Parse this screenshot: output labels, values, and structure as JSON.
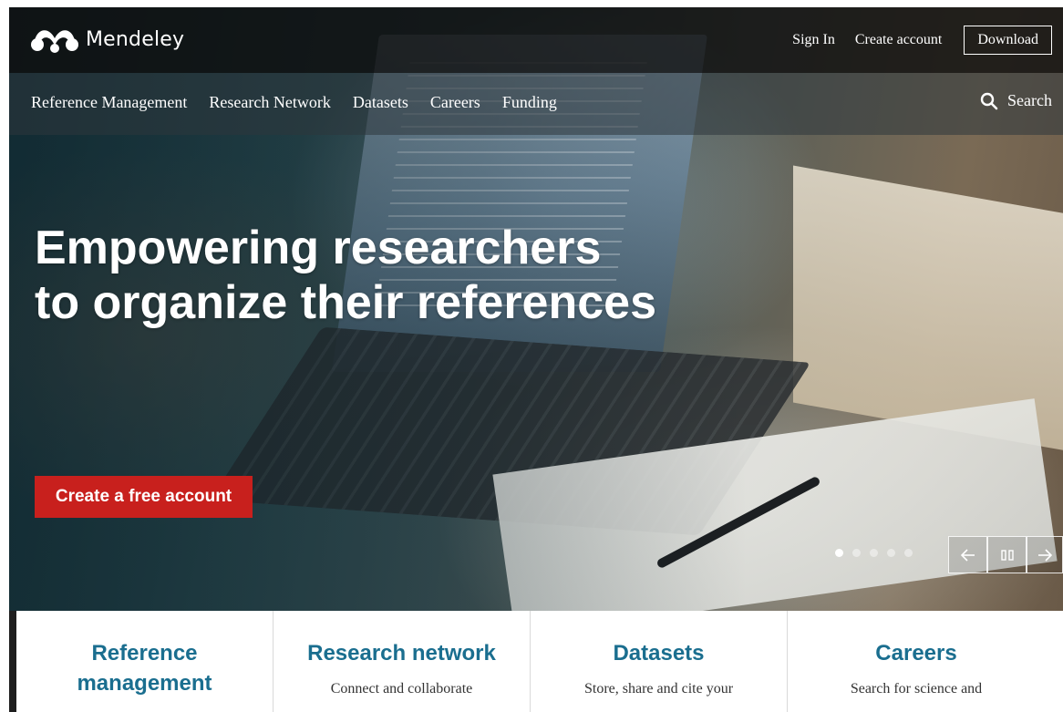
{
  "header": {
    "brand": "Mendeley",
    "links": [
      {
        "label": "Sign In"
      },
      {
        "label": "Create account"
      }
    ],
    "download_label": "Download"
  },
  "nav": {
    "items": [
      {
        "label": "Reference Management"
      },
      {
        "label": "Research Network"
      },
      {
        "label": "Datasets"
      },
      {
        "label": "Careers"
      },
      {
        "label": "Funding"
      }
    ],
    "search_label": "Search",
    "search_icon": "search-icon"
  },
  "hero": {
    "headline_line1": "Empowering researchers",
    "headline_line2": "to organize their references",
    "cta_label": "Create a free account",
    "cta_color": "#c8201d",
    "carousel": {
      "slides": 5,
      "active_index": 0
    }
  },
  "cards": [
    {
      "title": "Reference management",
      "desc": ""
    },
    {
      "title": "Research network",
      "desc": "Connect and collaborate"
    },
    {
      "title": "Datasets",
      "desc": "Store, share and cite your"
    },
    {
      "title": "Careers",
      "desc": "Search for science and"
    }
  ],
  "colors": {
    "accent_title": "#1a6e8f",
    "topbar": "#0f0f0f"
  }
}
